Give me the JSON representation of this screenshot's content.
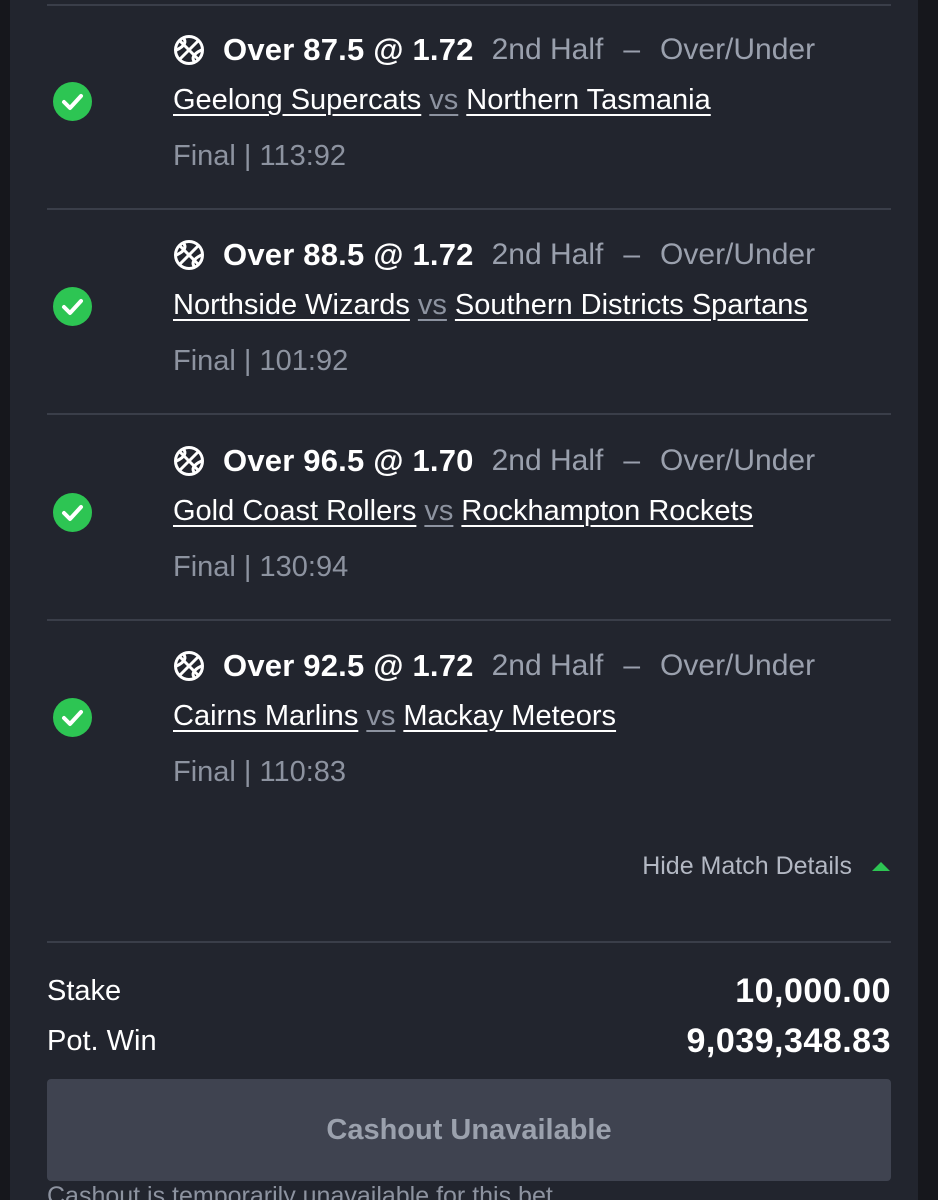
{
  "legs": [
    {
      "selection": "Over 87.5 @ 1.72",
      "market": "2nd Half",
      "market_type": "Over/Under",
      "home_team": "Geelong Supercats",
      "vs": "vs",
      "away_team": "Northern Tasmania",
      "result": "Final | 113:92",
      "status": "won",
      "sport_icon": "basketball-icon"
    },
    {
      "selection": "Over 88.5 @ 1.72",
      "market": "2nd Half",
      "market_type": "Over/Under",
      "home_team": "Northside Wizards",
      "vs": "vs",
      "away_team": "Southern Districts Spartans",
      "result": "Final | 101:92",
      "status": "won",
      "sport_icon": "basketball-icon"
    },
    {
      "selection": "Over 96.5 @ 1.70",
      "market": "2nd Half",
      "market_type": "Over/Under",
      "home_team": "Gold Coast Rollers",
      "vs": "vs",
      "away_team": "Rockhampton Rockets",
      "result": "Final | 130:94",
      "status": "won",
      "sport_icon": "basketball-icon"
    },
    {
      "selection": "Over 92.5 @ 1.72",
      "market": "2nd Half",
      "market_type": "Over/Under",
      "home_team": "Cairns Marlins",
      "vs": "vs",
      "away_team": "Mackay Meteors",
      "result": "Final | 110:83",
      "status": "won",
      "sport_icon": "basketball-icon"
    }
  ],
  "dash": "–",
  "hide_details_label": "Hide Match Details",
  "summary": {
    "stake_label": "Stake",
    "stake_value": "10,000.00",
    "pot_win_label": "Pot. Win",
    "pot_win_value": "9,039,348.83"
  },
  "cashout": {
    "button_label": "Cashout Unavailable",
    "note": "Cashout is temporarily unavailable for this bet"
  },
  "colors": {
    "background": "#22252e",
    "win_green": "#2dc553",
    "muted_text": "#8d93a0",
    "button_bg": "#3f4350"
  }
}
